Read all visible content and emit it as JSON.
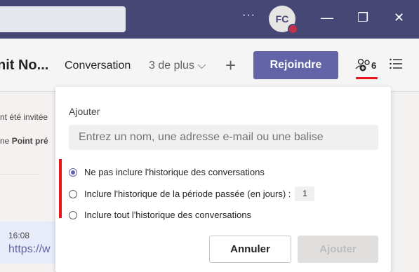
{
  "titlebar": {
    "more_label": "···",
    "avatar_initials": "FC",
    "presence_color": "#c4314b",
    "minimize": "—",
    "restore": "❐",
    "close": "✕"
  },
  "header": {
    "channel_title": "nit No...",
    "tab_conversation": "Conversation",
    "tab_more": "3 de plus ⌵",
    "add_tab": "+",
    "join_label": "Rejoindre",
    "participants_count": "6"
  },
  "background": {
    "line1": "nt été invitée",
    "line2_prefix": "ne ",
    "line2_bold": "Point pré",
    "message_time": "16:08",
    "message_link": "https://w"
  },
  "popup": {
    "label": "Ajouter",
    "input_placeholder": "Entrez un nom, une adresse e-mail ou une balise",
    "options": [
      {
        "label": "Ne pas inclure l'historique des conversations",
        "checked": true
      },
      {
        "label": "Inclure l'historique de la période passée (en jours) :",
        "checked": false,
        "days": "1"
      },
      {
        "label": "Inclure tout l'historique des conversations",
        "checked": false
      }
    ],
    "cancel_label": "Annuler",
    "add_label": "Ajouter"
  },
  "colors": {
    "titlebar": "#464775",
    "accent": "#6264a7",
    "annotation": "#e8161b"
  }
}
